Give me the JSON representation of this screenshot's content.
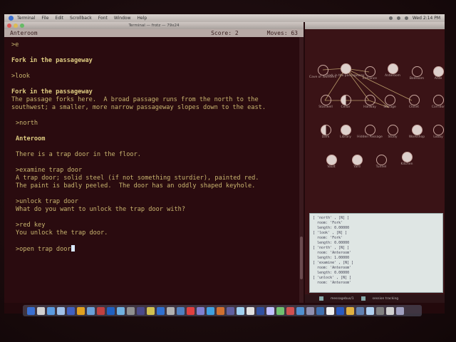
{
  "menubar": {
    "items": [
      "Terminal",
      "File",
      "Edit",
      "Scrollback",
      "Font",
      "Window",
      "Help"
    ],
    "clock": "Wed 2:14 PM"
  },
  "terminal": {
    "title": "Terminal — frotz — 79x24",
    "status": {
      "location": "Anteroom",
      "score": "Score: 2",
      "moves": "Moves: 63"
    },
    "lines": [
      ">e",
      "",
      "Fork in the passageway",
      "",
      ">look",
      "",
      "Fork in the passageway",
      "The passage forks here.  A broad passage runs from the north to the",
      "southwest; a smaller, more narrow passageway slopes down to the east.",
      "",
      ">north",
      "",
      "Anteroom",
      "",
      "There is a trap door in the floor.",
      "",
      ">examine trap door",
      "A trap door; solid steel (if not something sturdier), painted red.",
      "The paint is badly peeled.  The door has an oddly shaped keyhole.",
      "",
      ">unlock trap door",
      "What do you want to unlock the trap door with?",
      "",
      ">red key",
      "You unlock the trap door.",
      "",
      ">open trap door"
    ]
  },
  "map": {
    "nodes": [
      {
        "label": "Cave of Wonders",
        "style": "empty"
      },
      {
        "label": "Fork in the passageway",
        "style": "full"
      },
      {
        "label": "Entrance",
        "style": "empty"
      },
      {
        "label": "Anteroom",
        "style": "full"
      },
      {
        "label": "Bedroom",
        "style": "empty"
      },
      {
        "label": "Ante",
        "style": "full"
      },
      {
        "label": "Stairwell",
        "style": "empty"
      },
      {
        "label": "Cellar",
        "style": "half"
      },
      {
        "label": "Hallway",
        "style": "empty"
      },
      {
        "label": "Storage",
        "style": "empty"
      },
      {
        "label": "Closet",
        "style": "empty"
      },
      {
        "label": "Corridor",
        "style": "empty"
      },
      {
        "label": "Dark",
        "style": "half"
      },
      {
        "label": "Library",
        "style": "full"
      },
      {
        "label": "Hidden Passage",
        "style": "empty"
      },
      {
        "label": "Study",
        "style": "empty"
      },
      {
        "label": "Workshop",
        "style": "full"
      },
      {
        "label": "Lobby",
        "style": "empty"
      },
      {
        "label": "Vault",
        "style": "full"
      },
      {
        "label": "Yard",
        "style": "full"
      },
      {
        "label": "Tunnel",
        "style": "empty"
      },
      {
        "label": "Kitchen",
        "style": "full"
      }
    ]
  },
  "log": {
    "text": "[ 'north' , [N] ]\n  room: 'Fork'\n  length: 0.00000\n[ 'look' , [N] ]\n  room: 'Fork'\n  length: 0.00000\n[ 'north' , [N] ]\n  room: 'Anteroom'\n  length: 1.00000\n[ 'examine' , [N] ]\n  room: 'Anteroom'\n  length: 0.00000\n[ 'unlock' , [N] ]\n  room: 'Anteroom'",
    "footer": [
      "messagebus/1",
      "session tracking"
    ]
  },
  "colors": {
    "terminal_bg": "#2a0b0f",
    "terminal_text": "#c9b56f",
    "status_bar": "#b8aaa6",
    "cursor": "#d8e8ff"
  }
}
